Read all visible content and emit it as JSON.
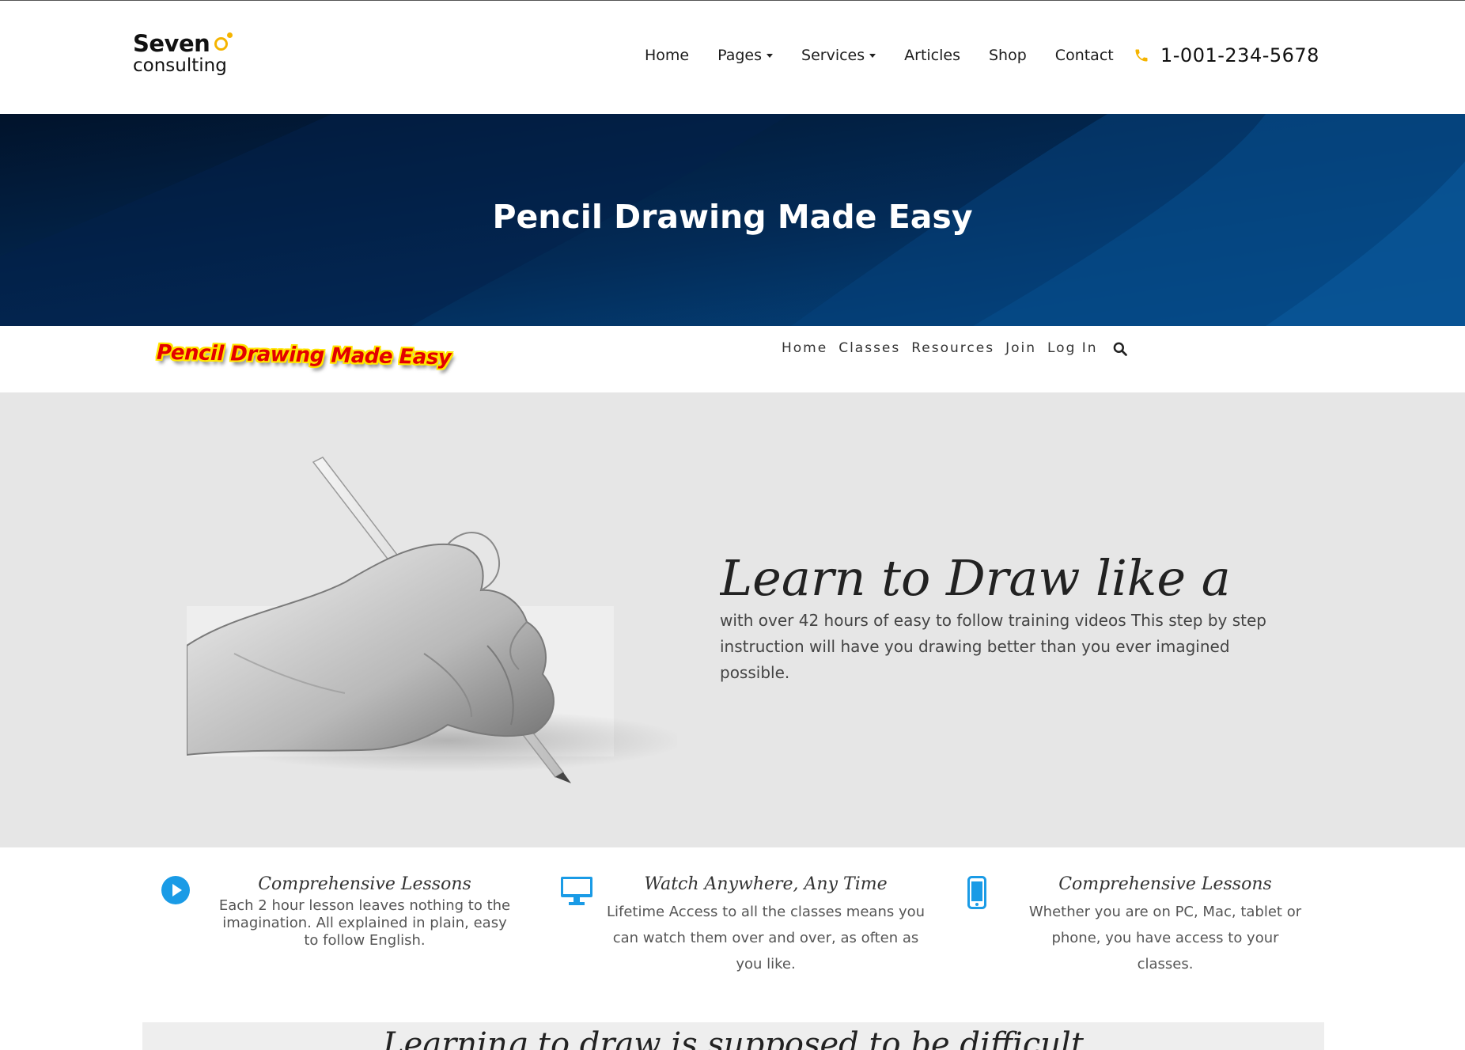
{
  "site": {
    "logo_line1": "Seven",
    "logo_line2": "consulting",
    "nav": [
      {
        "label": "Home",
        "dropdown": false
      },
      {
        "label": "Pages",
        "dropdown": true
      },
      {
        "label": "Services",
        "dropdown": true
      },
      {
        "label": "Articles",
        "dropdown": false
      },
      {
        "label": "Shop",
        "dropdown": false
      },
      {
        "label": "Contact",
        "dropdown": false
      }
    ],
    "phone": "1-001-234-5678",
    "accent_color": "#f5b400"
  },
  "hero": {
    "title": "Pencil Drawing Made Easy",
    "bg_color": "#021b3b"
  },
  "inner_site": {
    "logo_text": "Pencil Drawing Made Easy",
    "nav": [
      "Home",
      "Classes",
      "Resources",
      "Join",
      "Log In"
    ],
    "search_icon": "search-icon"
  },
  "feature": {
    "headline": "Learn to Draw like a",
    "text": "with over 42 hours of easy to follow training videos This step by step instruction will have you drawing better than you ever imagined possible.",
    "image": "hand-drawing-with-pencil"
  },
  "features": [
    {
      "icon": "play-circle-icon",
      "title": "Comprehensive Lessons",
      "text": "Each 2 hour lesson leaves nothing to the imagination. All explained in plain, easy to follow English."
    },
    {
      "icon": "monitor-icon",
      "title": "Watch Anywhere, Any Time",
      "text": "Lifetime Access to all the classes means you can watch them over and over, as often as you like."
    },
    {
      "icon": "smartphone-icon",
      "title": "Comprehensive Lessons",
      "text": "Whether you are on PC, Mac, tablet or phone, you have access to your classes."
    }
  ],
  "icon_color": "#1a9be6",
  "bottom": {
    "headline": "Learning to draw is supposed to be difficult"
  }
}
